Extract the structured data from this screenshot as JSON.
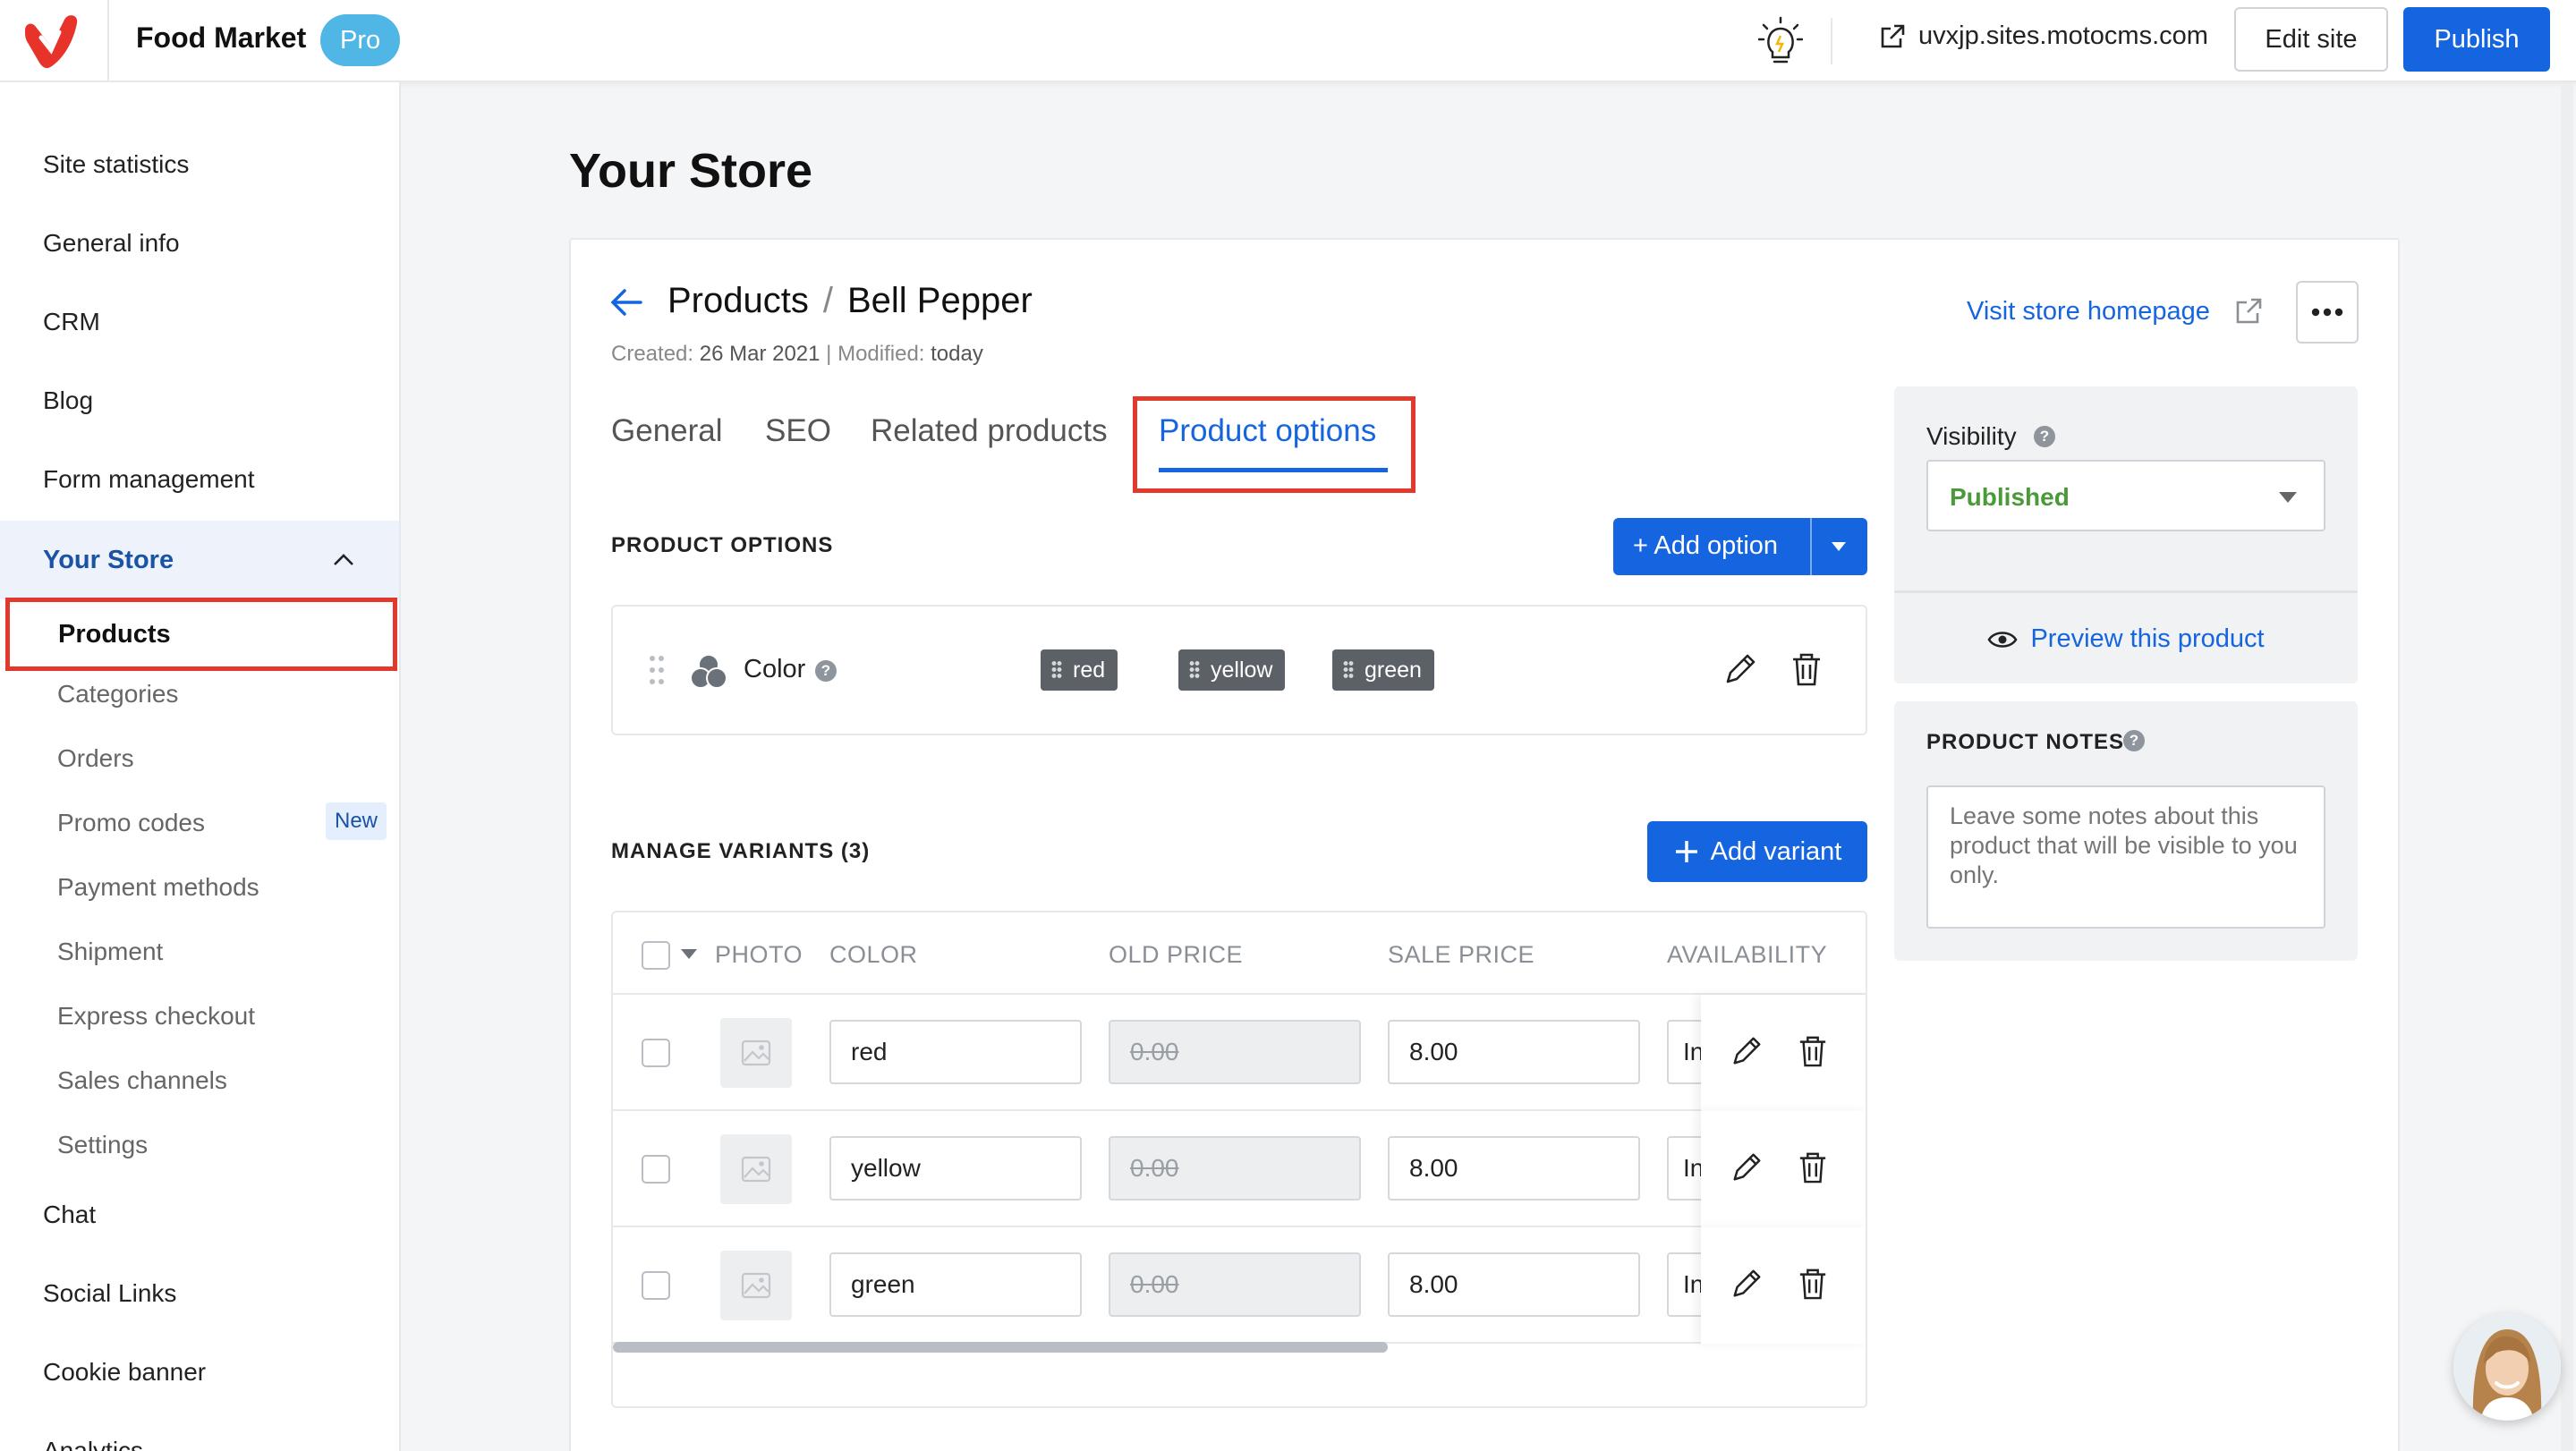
{
  "header": {
    "site_name": "Food Market",
    "plan_badge": "Pro",
    "site_url": "uvxjp.sites.motocms.com",
    "edit_label": "Edit site",
    "publish_label": "Publish"
  },
  "sidebar": {
    "items": [
      "Site statistics",
      "General info",
      "CRM",
      "Blog",
      "Form management"
    ],
    "store_group": "Your Store",
    "store_items": [
      "Products",
      "Categories",
      "Orders",
      "Promo codes",
      "Payment methods",
      "Shipment",
      "Express checkout",
      "Sales channels",
      "Settings"
    ],
    "new_badge": "New",
    "bottom_items": [
      "Chat",
      "Social Links",
      "Cookie banner",
      "Analytics"
    ]
  },
  "page": {
    "title": "Your Store",
    "breadcrumb_parent": "Products",
    "breadcrumb_sep": "/",
    "breadcrumb_current": "Bell Pepper",
    "created_label": "Created:",
    "created_value": "26 Mar 2021",
    "modified_label": "| Modified:",
    "modified_value": "today",
    "visit_link": "Visit store homepage"
  },
  "tabs": [
    "General",
    "SEO",
    "Related products",
    "Product options"
  ],
  "options": {
    "heading": "PRODUCT OPTIONS",
    "add_option_label": "+ Add option",
    "option_name": "Color",
    "values": [
      "red",
      "yellow",
      "green"
    ]
  },
  "variants": {
    "heading": "MANAGE VARIANTS (3)",
    "add_variant_label": "Add variant",
    "columns": [
      "PHOTO",
      "COLOR",
      "OLD PRICE",
      "SALE PRICE",
      "AVAILABILITY"
    ],
    "rows": [
      {
        "color": "red",
        "old_price": "0.00",
        "sale_price": "8.00",
        "availability": "In"
      },
      {
        "color": "yellow",
        "old_price": "0.00",
        "sale_price": "8.00",
        "availability": "In"
      },
      {
        "color": "green",
        "old_price": "0.00",
        "sale_price": "8.00",
        "availability": "In"
      }
    ]
  },
  "right_panel": {
    "visibility_label": "Visibility",
    "visibility_value": "Published",
    "preview_label": "Preview this product",
    "notes_heading": "PRODUCT NOTES",
    "notes_placeholder": "Leave some notes about this product that will be visible to you only."
  },
  "help_glyph": "?",
  "colors": {
    "accent": "#1565e0",
    "highlight": "#e2392d",
    "published": "#4a9a3a",
    "chip": "#5b6167"
  }
}
